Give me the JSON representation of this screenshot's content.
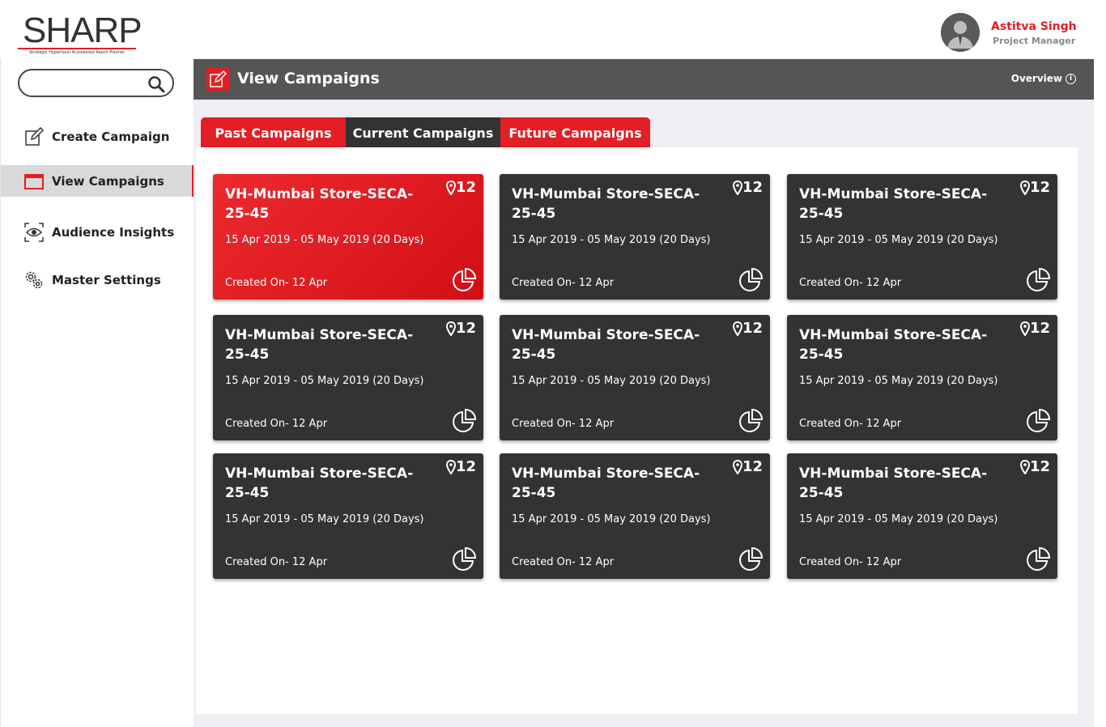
{
  "brand": {
    "logo_text": "SHARP",
    "tagline": "Strategic Hyperlocal AI-powered Reach Planner",
    "accent_color": "#e31e24"
  },
  "user": {
    "name": "Astitva Singh",
    "role": "Project Manager"
  },
  "search": {
    "value": "",
    "placeholder": ""
  },
  "sidebar": {
    "items": [
      {
        "label": "Create Campaign",
        "icon": "edit-icon",
        "active": false
      },
      {
        "label": "View Campaigns",
        "icon": "window-icon",
        "active": true
      },
      {
        "label": "Audience Insights",
        "icon": "eye-scan-icon",
        "active": false
      },
      {
        "label": "Master Settings",
        "icon": "gears-icon",
        "active": false
      }
    ]
  },
  "header": {
    "title": "View Campaigns",
    "overview_label": "Overview"
  },
  "tabs": [
    {
      "label": "Past Campaigns",
      "color": "#e31e24"
    },
    {
      "label": "Current Campaigns",
      "color": "#333333"
    },
    {
      "label": "Future Campaigns",
      "color": "#e31e24"
    }
  ],
  "cards": [
    {
      "name": "VH-Mumbai Store-SECA-25-45",
      "dates": "15 Apr 2019 - 05 May 2019 (20 Days)",
      "created": "Created On- 12 Apr",
      "locations": "12",
      "highlighted": true
    },
    {
      "name": "VH-Mumbai Store-SECA-25-45",
      "dates": "15 Apr 2019 - 05 May 2019 (20 Days)",
      "created": "Created On- 12 Apr",
      "locations": "12",
      "highlighted": false
    },
    {
      "name": "VH-Mumbai Store-SECA-25-45",
      "dates": "15 Apr 2019 - 05 May 2019 (20 Days)",
      "created": "Created On- 12 Apr",
      "locations": "12",
      "highlighted": false
    },
    {
      "name": "VH-Mumbai Store-SECA-25-45",
      "dates": "15 Apr 2019 - 05 May 2019 (20 Days)",
      "created": "Created On- 12 Apr",
      "locations": "12",
      "highlighted": false
    },
    {
      "name": "VH-Mumbai Store-SECA-25-45",
      "dates": "15 Apr 2019 - 05 May 2019 (20 Days)",
      "created": "Created On- 12 Apr",
      "locations": "12",
      "highlighted": false
    },
    {
      "name": "VH-Mumbai Store-SECA-25-45",
      "dates": "15 Apr 2019 - 05 May 2019 (20 Days)",
      "created": "Created On- 12 Apr",
      "locations": "12",
      "highlighted": false
    },
    {
      "name": "VH-Mumbai Store-SECA-25-45",
      "dates": "15 Apr 2019 - 05 May 2019 (20 Days)",
      "created": "Created On- 12 Apr",
      "locations": "12",
      "highlighted": false
    },
    {
      "name": "VH-Mumbai Store-SECA-25-45",
      "dates": "15 Apr 2019 - 05 May 2019 (20 Days)",
      "created": "Created On- 12 Apr",
      "locations": "12",
      "highlighted": false
    },
    {
      "name": "VH-Mumbai Store-SECA-25-45",
      "dates": "15 Apr 2019 - 05 May 2019 (20 Days)",
      "created": "Created On- 12 Apr",
      "locations": "12",
      "highlighted": false
    }
  ]
}
